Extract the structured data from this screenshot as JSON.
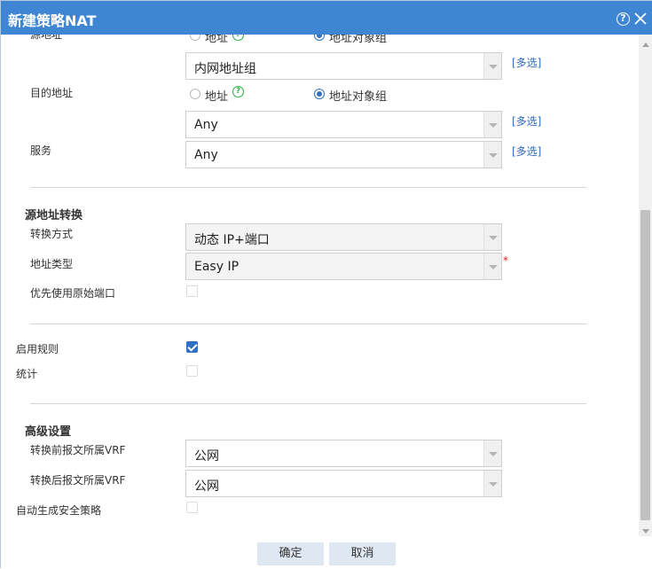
{
  "dialog": {
    "title": "新建策略NAT"
  },
  "source_address": {
    "label": "源地址",
    "radio_address": "地址",
    "radio_group": "地址对象组",
    "selected": "内网地址组",
    "multi": "[多选]"
  },
  "dest_address": {
    "label": "目的地址",
    "radio_address": "地址",
    "radio_group": "地址对象组",
    "selected": "Any",
    "multi": "[多选]"
  },
  "service": {
    "label": "服务",
    "selected": "Any",
    "multi": "[多选]"
  },
  "snat": {
    "title": "源地址转换",
    "mode_label": "转换方式",
    "mode_value": "动态 IP+端口",
    "type_label": "地址类型",
    "type_value": "Easy IP",
    "required_mark": "*",
    "prefer_label": "优先使用原始端口",
    "prefer_checked": false
  },
  "enable": {
    "label": "启用规则",
    "checked": true
  },
  "stats": {
    "label": "统计",
    "checked": false
  },
  "advanced": {
    "title": "高级设置",
    "vrf_before_label": "转换前报文所属VRF",
    "vrf_before_value": "公网",
    "vrf_after_label": "转换后报文所属VRF",
    "vrf_after_value": "公网",
    "auto_policy_label": "自动生成安全策略",
    "auto_policy_checked": false
  },
  "footer": {
    "ok": "确定",
    "cancel": "取消"
  },
  "colors": {
    "titlebar": "#3e85d4",
    "link": "#2d6cc0",
    "accent": "#2e70c5",
    "help": "#2fb048"
  }
}
